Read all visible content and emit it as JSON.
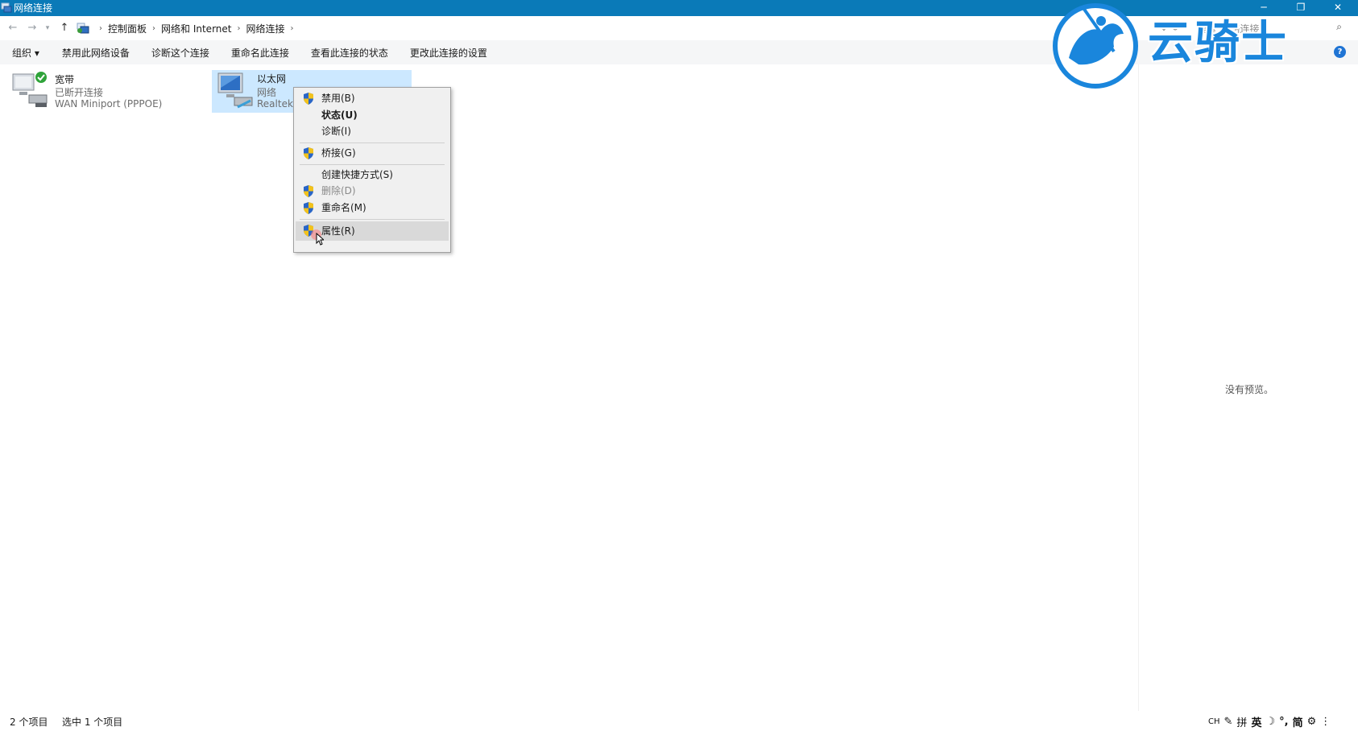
{
  "window": {
    "title": "网络连接",
    "controls": {
      "minimize": "─",
      "maximize": "❐",
      "close": "✕"
    }
  },
  "address": {
    "breadcrumb": [
      "控制面板",
      "网络和 Internet",
      "网络连接"
    ],
    "search_placeholder": "搜索\"网络连接\""
  },
  "toolbar": {
    "organize": "组织 ▾",
    "items": [
      "禁用此网络设备",
      "诊断这个连接",
      "重命名此连接",
      "查看此连接的状态",
      "更改此连接的设置"
    ]
  },
  "connections": [
    {
      "name": "宽带",
      "status": "已断开连接",
      "device": "WAN Miniport (PPPOE)"
    },
    {
      "name": "以太网",
      "status": "网络",
      "device": "Realtek"
    }
  ],
  "context_menu": {
    "items": [
      {
        "label": "禁用(B)",
        "shield": true
      },
      {
        "label": "状态(U)",
        "shield": false,
        "bold": true
      },
      {
        "label": "诊断(I)",
        "shield": false
      },
      {
        "label": "桥接(G)",
        "shield": true
      },
      {
        "label": "创建快捷方式(S)",
        "shield": false
      },
      {
        "label": "删除(D)",
        "shield": true,
        "disabled": true
      },
      {
        "label": "重命名(M)",
        "shield": true
      },
      {
        "label": "属性(R)",
        "shield": true,
        "hover": true
      }
    ]
  },
  "preview": {
    "empty_text": "没有预览。"
  },
  "status": {
    "count": "2 个项目",
    "selected": "选中 1 个项目"
  },
  "ime": {
    "lang": "CH",
    "mode": "英",
    "layout": "简",
    "pinyin": "拼"
  },
  "watermark": {
    "text": "云骑士"
  },
  "colors": {
    "titlebar": "#0a7ab8",
    "selection": "#cce8ff",
    "menu_bg": "#f0f0f0",
    "watermark": "#1a86dc"
  }
}
